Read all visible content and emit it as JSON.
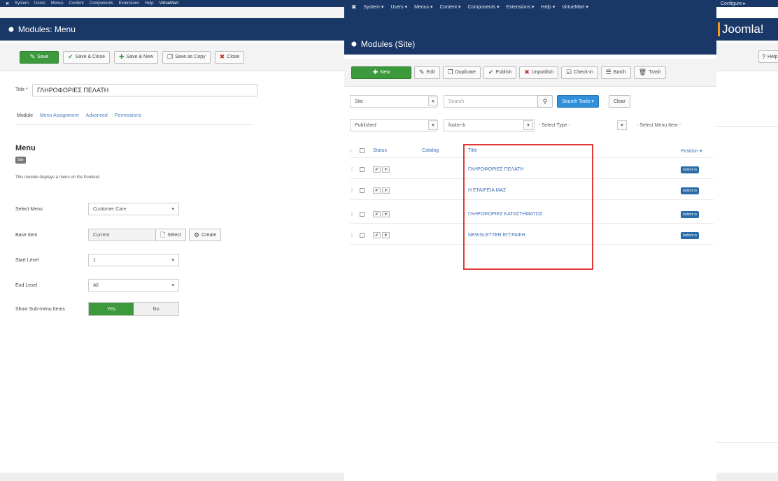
{
  "left": {
    "topbar": {
      "items": [
        "System",
        "Users",
        "Menus",
        "Content",
        "Components",
        "Extensions",
        "Help",
        "VirtueMart"
      ]
    },
    "header": {
      "title": "Modules: Menu"
    },
    "toolbar": {
      "save": "Save",
      "save_close": "Save & Close",
      "save_new": "Save & New",
      "save_copy": "Save as Copy",
      "close": "Close"
    },
    "title_label": "Title *",
    "title_value": "ΓΛΗΡΟΦΟΡΙΕΣ ΠΕΛΑΤΗ",
    "tabs": [
      "Module",
      "Menu Assignment",
      "Advanced",
      "Permissions"
    ],
    "module_name": "Menu",
    "site_badge": "Site",
    "description": "This module displays a menu on the frontend.",
    "fields": {
      "select_menu_label": "Select Menu",
      "select_menu_value": "Customer Care",
      "base_item_label": "Base Item",
      "base_item_value": "Current",
      "select_btn": "Select",
      "create_btn": "Create",
      "start_level_label": "Start Level",
      "start_level_value": "1",
      "end_level_label": "End Level",
      "end_level_value": "All",
      "show_sub_label": "Show Sub-menu Items",
      "yes": "Yes",
      "no": "No"
    }
  },
  "right": {
    "topbar": {
      "items": [
        "System ▾",
        "Users ▾",
        "Menus ▾",
        "Content ▾",
        "Components ▾",
        "Extensions ▾",
        "Help ▾",
        "VirtueMart ▾"
      ]
    },
    "header": {
      "title": "Modules (Site)"
    },
    "toolbar": {
      "new": "New",
      "edit": "Edit",
      "duplicate": "Duplicate",
      "publish": "Publish",
      "unpublish": "Unpublish",
      "checkin": "Check-in",
      "batch": "Batch",
      "trash": "Trash"
    },
    "filters": {
      "site": "Site",
      "search_placeholder": "Search",
      "search_tools": "Search Tools ▾",
      "clear": "Clear",
      "status": "Published",
      "position": "footer-b",
      "type": "- Select Type -",
      "menu_item": "- Select Menu Item -"
    },
    "table": {
      "headers": {
        "status": "Status",
        "catalog": "Catalog",
        "title": "Title",
        "position": "Position ▾"
      },
      "rows": [
        {
          "title": "ΓΛΗΡΟΦΟΡΙΕΣ ΠΕΛΑΤΗ",
          "position": "bottom-b"
        },
        {
          "title": "Η ΕΤΑΙΡΕΙΑ ΜΑΣ",
          "position": "bottom-b"
        },
        {
          "title": "ΓΛΗΡΟΦΟΡΙΕΣ ΚΑΤΑΣΤΗΜΑΤΟΣ",
          "position": "bottom-b"
        },
        {
          "title": "NEWSLETTER ΕΓΓΡΑΦΗ",
          "position": "bottom-b"
        }
      ]
    }
  },
  "far_right": {
    "logo": "Joomla!",
    "user": "Configure ▸",
    "help": "Help"
  },
  "colors": {
    "navy": "#1a3867",
    "green": "#3c9a3d",
    "link": "#3d6fb4",
    "highlight": "#e03a3a"
  }
}
